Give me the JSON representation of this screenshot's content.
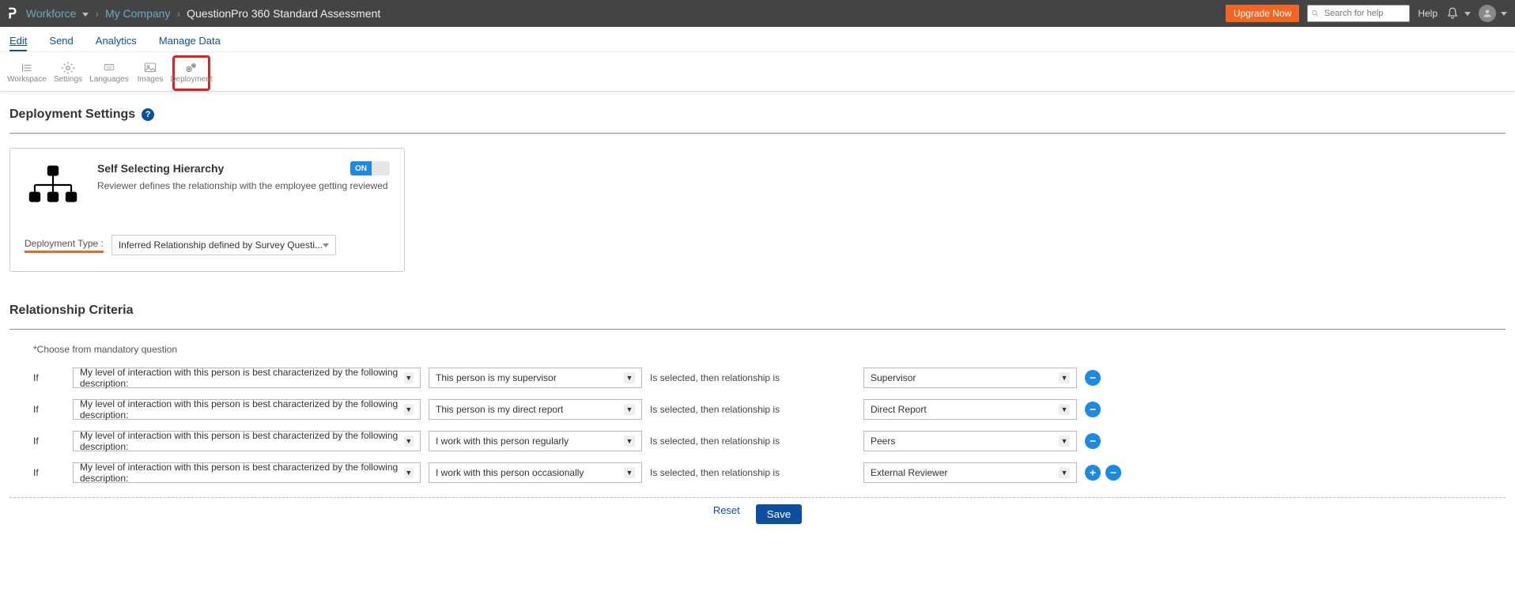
{
  "topbar": {
    "product": "Workforce",
    "company": "My Company",
    "assessment": "QuestionPro 360 Standard Assessment",
    "upgrade": "Upgrade Now",
    "search_placeholder": "Search for help",
    "help": "Help"
  },
  "tabs": {
    "edit": "Edit",
    "send": "Send",
    "analytics": "Analytics",
    "manage": "Manage Data"
  },
  "toolbar": {
    "workspace": "Workspace",
    "settings": "Settings",
    "languages": "Languages",
    "images": "Images",
    "deployment": "Deployment"
  },
  "deployment": {
    "section_title": "Deployment Settings",
    "card_title": "Self Selecting Hierarchy",
    "card_desc": "Reviewer defines the relationship with the employee getting reviewed",
    "toggle_on": "ON",
    "type_label": "Deployment Type :",
    "type_value": "Inferred Relationship defined by Survey Questi..."
  },
  "criteria": {
    "title": "Relationship Criteria",
    "hint": "*Choose from mandatory question",
    "if_label": "If",
    "mid_text": "Is selected, then relationship is",
    "rows": [
      {
        "question": "My level of interaction with this person is best characterized by the following description:",
        "answer": "This person is my supervisor",
        "relationship": "Supervisor"
      },
      {
        "question": "My level of interaction with this person is best characterized by the following description:",
        "answer": "This person is my direct report",
        "relationship": "Direct Report"
      },
      {
        "question": "My level of interaction with this person is best characterized by the following description:",
        "answer": "I work with this person regularly",
        "relationship": "Peers"
      },
      {
        "question": "My level of interaction with this person is best characterized by the following description:",
        "answer": "I work with this person occasionally",
        "relationship": "External Reviewer"
      }
    ],
    "reset": "Reset",
    "save": "Save"
  }
}
